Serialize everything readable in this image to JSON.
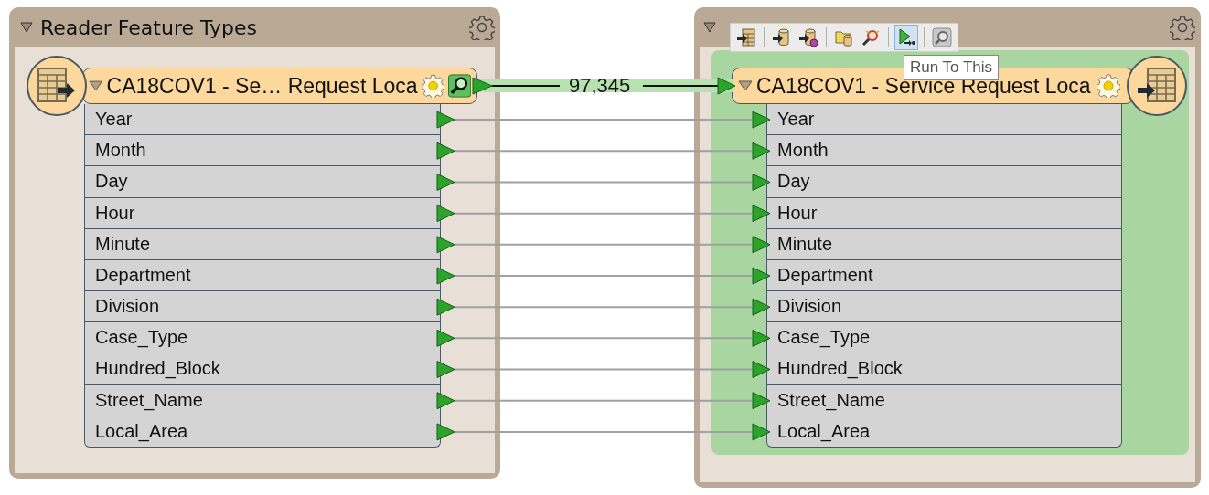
{
  "reader": {
    "title": "Reader Feature Types",
    "feature_type": {
      "name": "CA18COV1 - Se… Request Loca",
      "attributes": [
        "Year",
        "Month",
        "Day",
        "Hour",
        "Minute",
        "Department",
        "Division",
        "Case_Type",
        "Hundred_Block",
        "Street_Name",
        "Local_Area"
      ]
    }
  },
  "connection": {
    "count": "97,345"
  },
  "writer": {
    "feature_type": {
      "name": "CA18COV1 - Service Request Loca",
      "attributes": [
        "Year",
        "Month",
        "Day",
        "Hour",
        "Minute",
        "Department",
        "Division",
        "Case_Type",
        "Hundred_Block",
        "Street_Name",
        "Local_Area"
      ]
    }
  },
  "toolbar": {
    "groups": [
      [
        {
          "kind": "table",
          "selected": false
        }
      ],
      [
        {
          "kind": "db",
          "selected": false
        },
        {
          "kind": "dbgear",
          "selected": false
        }
      ],
      [
        {
          "kind": "folder",
          "selected": false
        },
        {
          "kind": "inspect",
          "selected": false
        }
      ],
      [
        {
          "kind": "run",
          "selected": true
        }
      ],
      [
        {
          "kind": "zoom",
          "selected": false
        }
      ]
    ],
    "tooltip": "Run To This"
  }
}
